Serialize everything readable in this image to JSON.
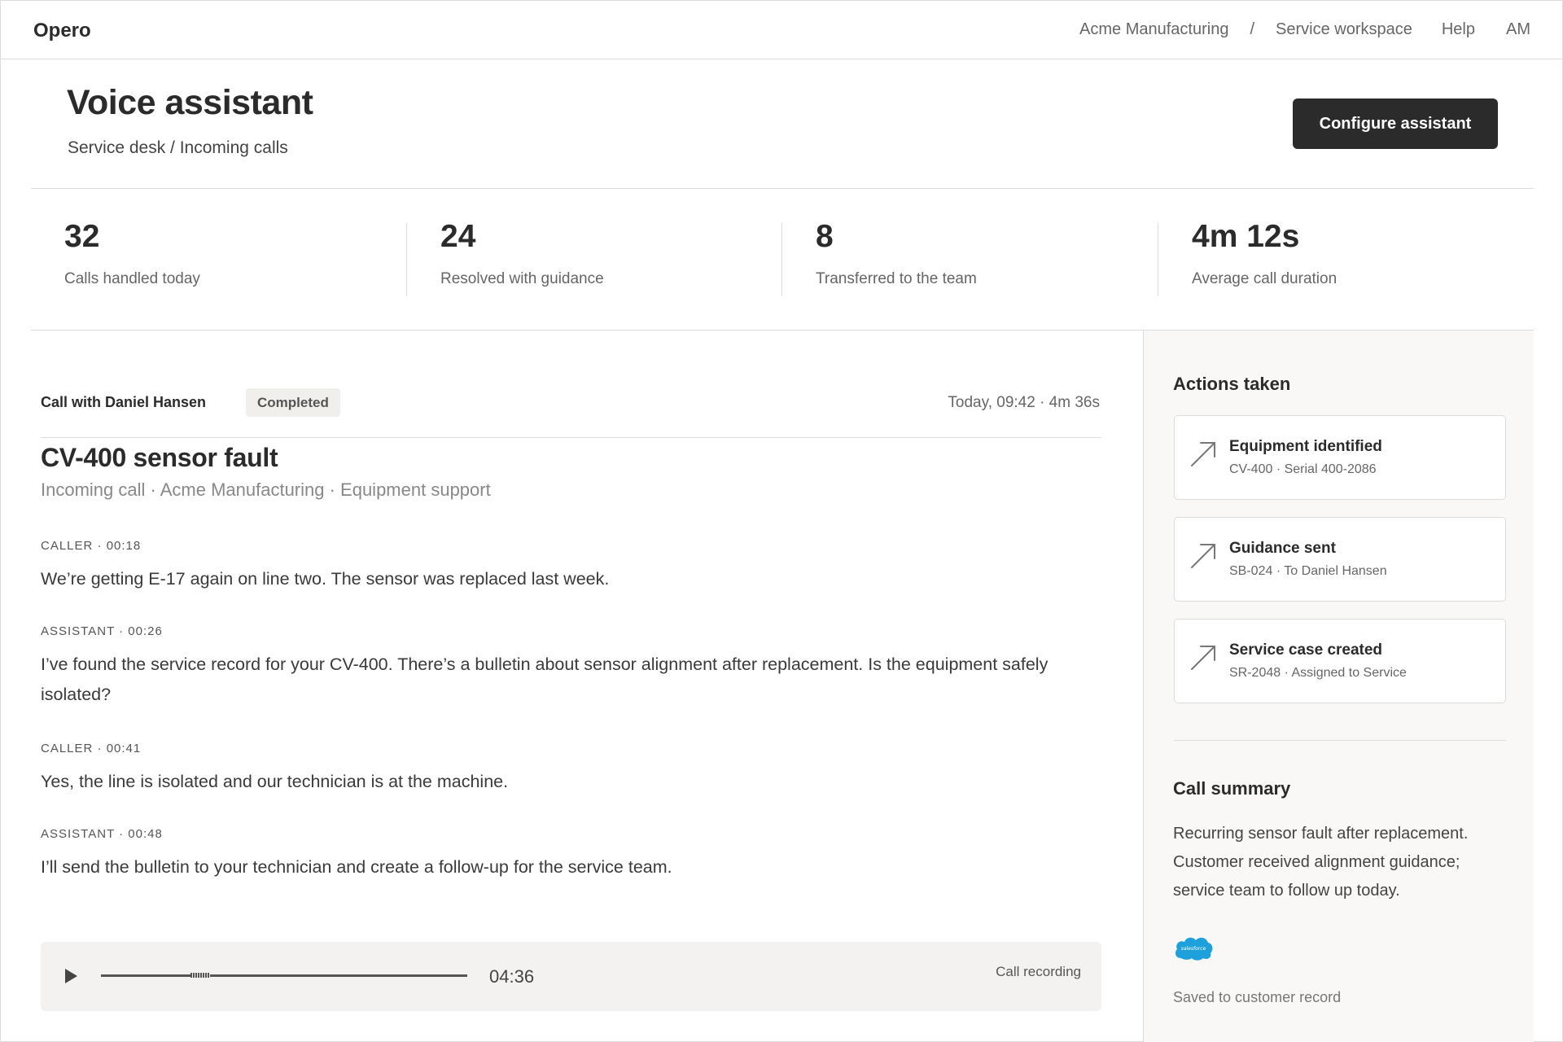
{
  "app": {
    "logo": "Opero",
    "org": "Acme Manufacturing",
    "separator": "/",
    "workspace": "Service workspace",
    "help": "Help",
    "user_initials": "AM"
  },
  "header": {
    "title": "Voice assistant",
    "breadcrumb": "Service desk / Incoming calls",
    "configure_label": "Configure assistant"
  },
  "stats": [
    {
      "value": "32",
      "label": "Calls handled today"
    },
    {
      "value": "24",
      "label": "Resolved with guidance"
    },
    {
      "value": "8",
      "label": "Transferred to the team"
    },
    {
      "value": "4m 12s",
      "label": "Average call duration"
    }
  ],
  "call": {
    "with": "Call with Daniel Hansen",
    "status": "Completed",
    "time": "Today, 09:42 · 4m 36s",
    "title": "CV-400 sensor fault",
    "meta": "Incoming call · Acme Manufacturing · Equipment support",
    "messages": [
      {
        "label": "CALLER · 00:18",
        "text": "We’re getting E-17 again on line two. The sensor was replaced last week."
      },
      {
        "label": "ASSISTANT · 00:26",
        "text": "I’ve found the service record for your CV-400. There’s a bulletin about sensor alignment after replacement. Is the equipment safely isolated?"
      },
      {
        "label": "CALLER · 00:41",
        "text": "Yes, the line is isolated and our technician is at the machine."
      },
      {
        "label": "ASSISTANT · 00:48",
        "text": "I’ll send the bulletin to your technician and create a follow-up for the service team."
      }
    ],
    "player": {
      "duration": "04:36",
      "label": "Call recording",
      "progress": 0.27
    }
  },
  "side": {
    "actions_heading": "Actions taken",
    "actions": [
      {
        "title": "Equipment identified",
        "sub": "CV-400 · Serial 400-2086",
        "icon": "arrow-up-right-icon"
      },
      {
        "title": "Guidance sent",
        "sub": "SB-024 · To Daniel Hansen",
        "icon": "arrow-up-right-icon"
      },
      {
        "title": "Service case created",
        "sub": "SR-2048 · Assigned to Service",
        "icon": "arrow-up-right-icon"
      }
    ],
    "summary_heading": "Call summary",
    "summary": "Recurring sensor fault after replacement. Customer received alignment guidance; service team to follow up today.",
    "logo_text": "salesforce",
    "saved": "Saved to customer record"
  },
  "colors": {
    "accent_dark": "#2b2b2b",
    "salesforce_blue": "#1ea0dc",
    "panel_bg": "#f9f8f6"
  }
}
